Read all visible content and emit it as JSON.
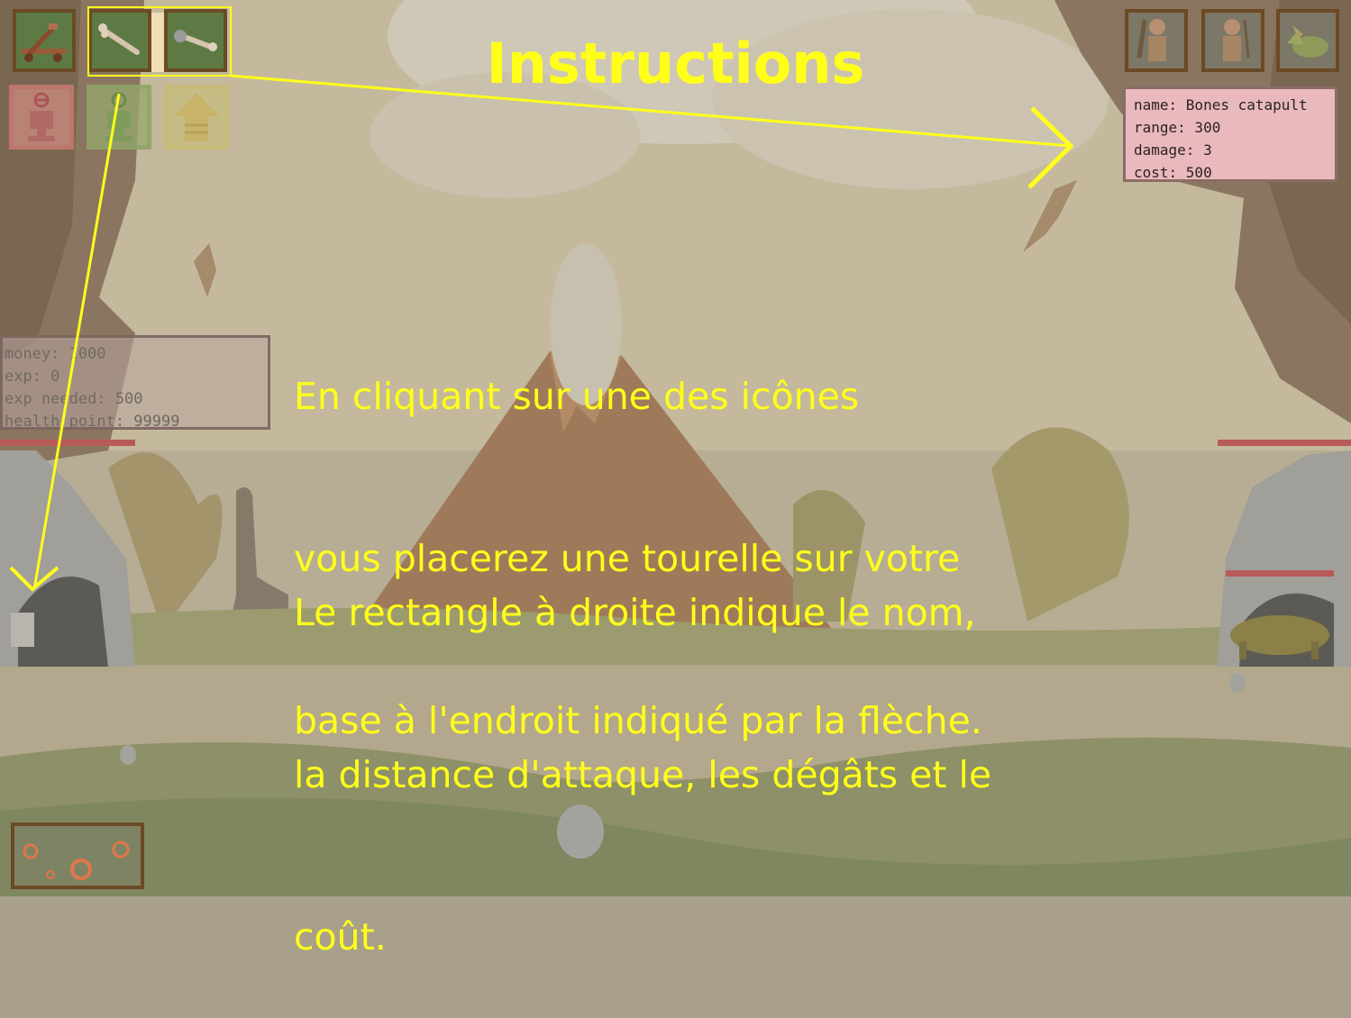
{
  "title": "Instructions",
  "paragraph_1": [
    "En cliquant sur une des icônes",
    "vous placerez une tourelle sur votre",
    "base à l'endroit indiqué par la flèche."
  ],
  "paragraph_2": [
    "Le rectangle à droite indique le nom,",
    "la distance d'attaque, les dégâts et le",
    "coût."
  ],
  "player_stats": [
    "money: 1000",
    "exp: 0",
    "exp needed: 500",
    "health point: 99999"
  ],
  "turret_info": [
    "name: Bones catapult",
    "range: 300",
    "damage: 3",
    "cost: 500"
  ],
  "turret_icons": [
    "catapult-icon",
    "bone-launcher-icon",
    "bone-sling-icon"
  ],
  "action_icons": [
    "remove-turret-icon",
    "add-turret-icon",
    "evolve-arrow-icon"
  ],
  "unit_icons": [
    "caveman-club-icon",
    "caveman-slinger-icon",
    "triceratops-icon"
  ],
  "special_icon": "meteor-fire-icon",
  "colors": {
    "annotation": "#ffff1a",
    "hp_bar": "#b85a5a",
    "info_panel_bg": "#e9b9bd",
    "turret_slot_bg": "#5d7a45",
    "slot_border": "#6b4a25"
  }
}
